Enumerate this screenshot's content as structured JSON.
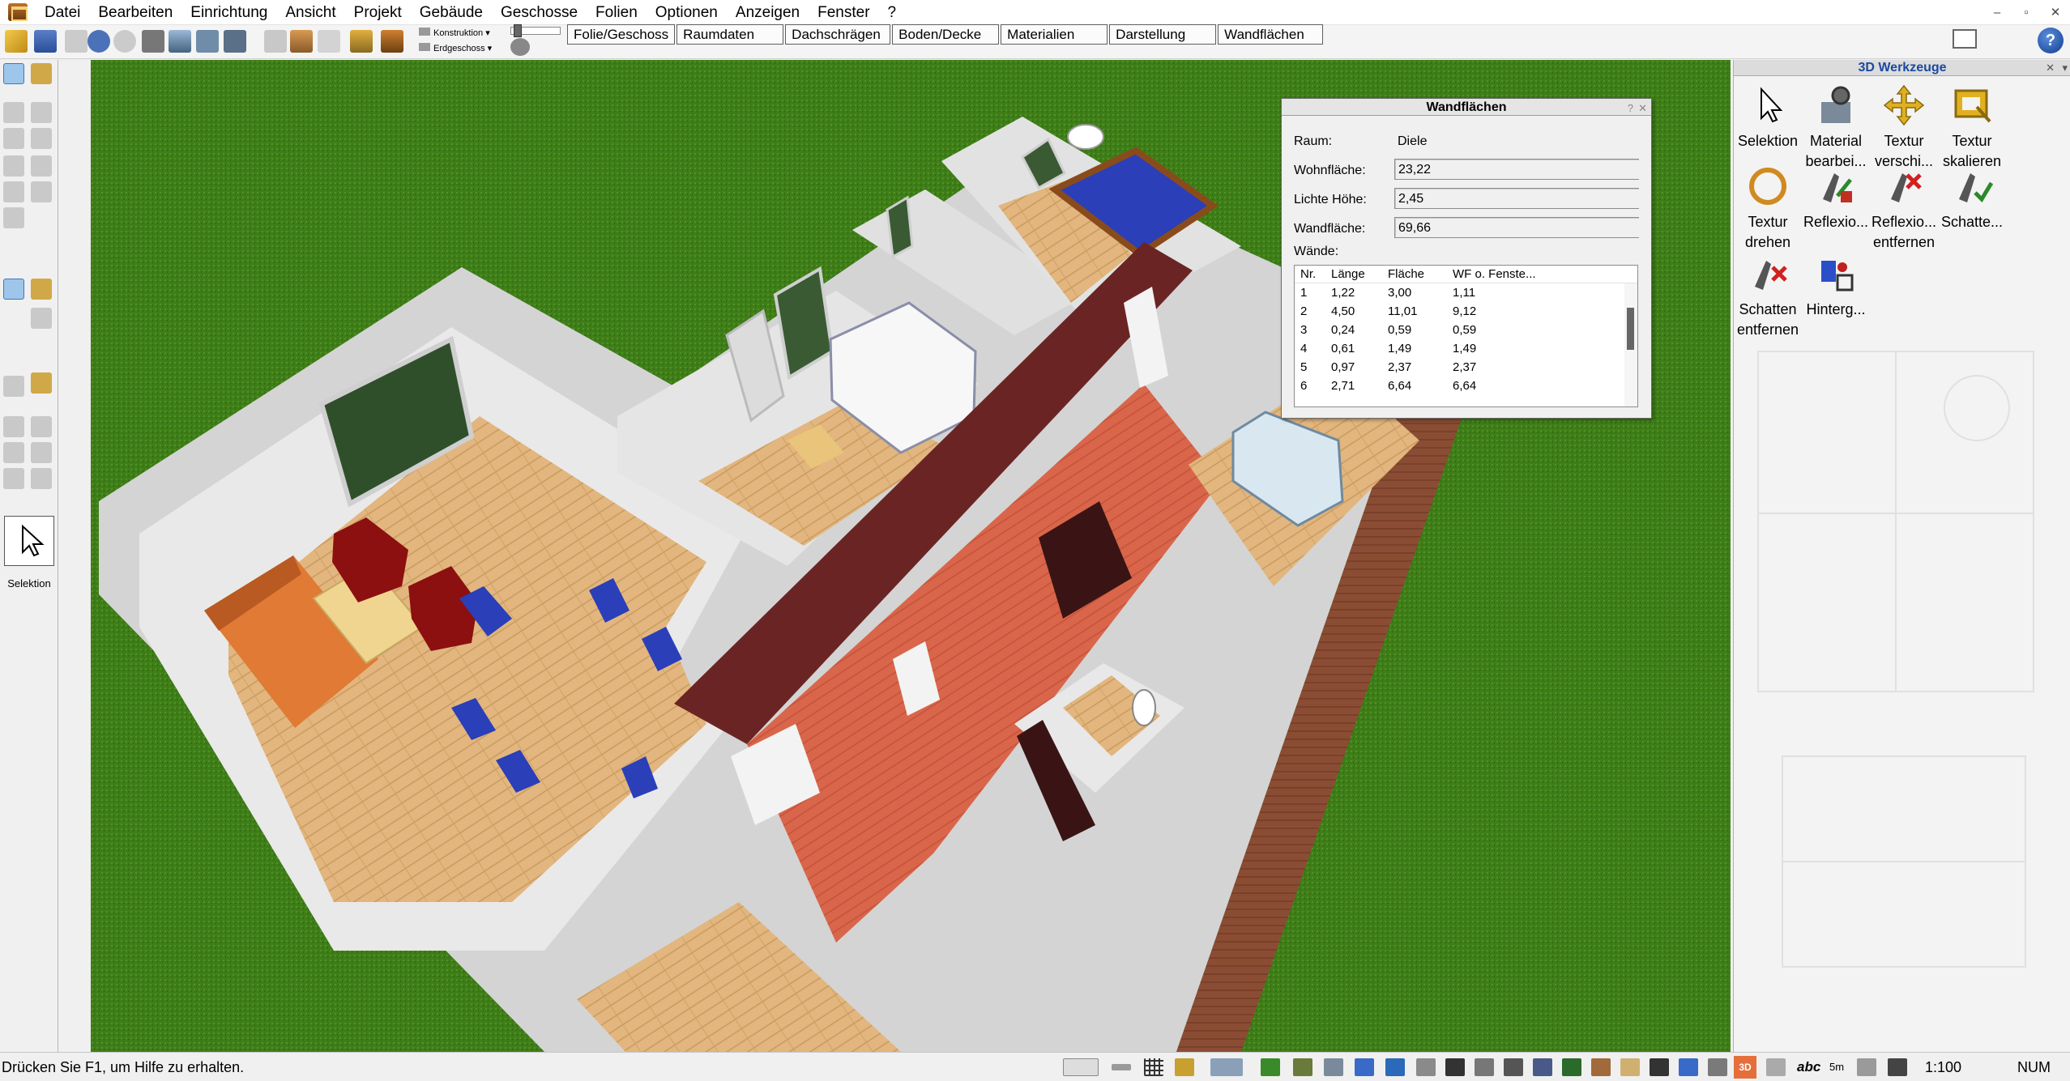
{
  "menu": [
    "Datei",
    "Bearbeiten",
    "Einrichtung",
    "Ansicht",
    "Projekt",
    "Gebäude",
    "Geschosse",
    "Folien",
    "Optionen",
    "Anzeigen",
    "Fenster",
    "?"
  ],
  "window_controls": [
    "–",
    "▫",
    "✕"
  ],
  "toolbar": {
    "konstruktion_label": "Konstruktion ▾",
    "erdgeschoss_label": "Erdgeschoss ▾"
  },
  "tabs": [
    "Folie/Geschoss",
    "Raumdaten",
    "Dachschrägen",
    "Boden/Decke",
    "Materialien",
    "Darstellung",
    "Wandflächen"
  ],
  "help_label": "?",
  "left_strip": {
    "selection_label": "Selektion"
  },
  "dialog": {
    "title": "Wandflächen",
    "title_controls": [
      "?",
      "✕"
    ],
    "raum_label": "Raum:",
    "raum_value": "Diele",
    "wohnflaeche_label": "Wohnfläche:",
    "wohnflaeche_value": "23,22",
    "lichte_hoehe_label": "Lichte Höhe:",
    "lichte_hoehe_value": "2,45",
    "wandflaeche_label": "Wandfläche:",
    "wandflaeche_value": "69,66",
    "waende_label": "Wände:",
    "columns": [
      "Nr.",
      "Länge",
      "Fläche",
      "WF o. Fenste..."
    ],
    "rows": [
      [
        "1",
        "1,22",
        "3,00",
        "1,11"
      ],
      [
        "2",
        "4,50",
        "11,01",
        "9,12"
      ],
      [
        "3",
        "0,24",
        "0,59",
        "0,59"
      ],
      [
        "4",
        "0,61",
        "1,49",
        "1,49"
      ],
      [
        "5",
        "0,97",
        "2,37",
        "2,37"
      ],
      [
        "6",
        "2,71",
        "6,64",
        "6,64"
      ]
    ]
  },
  "right_panel": {
    "title": "3D Werkzeuge",
    "title_controls": [
      "✕",
      "▾"
    ],
    "tools": [
      {
        "label1": "Selektion",
        "label2": "",
        "icon": "cursor-icon"
      },
      {
        "label1": "Material",
        "label2": "bearbei...",
        "icon": "material-edit-icon"
      },
      {
        "label1": "Textur",
        "label2": "verschi...",
        "icon": "texture-move-icon"
      },
      {
        "label1": "Textur",
        "label2": "skalieren",
        "icon": "texture-scale-icon"
      },
      {
        "label1": "Textur",
        "label2": "drehen",
        "icon": "texture-rotate-icon"
      },
      {
        "label1": "Reflexio...",
        "label2": "",
        "icon": "reflection-icon"
      },
      {
        "label1": "Reflexio...",
        "label2": "entfernen",
        "icon": "reflection-remove-icon"
      },
      {
        "label1": "Schatte...",
        "label2": "",
        "icon": "shadow-icon"
      },
      {
        "label1": "Schatten",
        "label2": "entfernen",
        "icon": "shadow-remove-icon"
      },
      {
        "label1": "Hinterg...",
        "label2": "",
        "icon": "background-icon"
      }
    ]
  },
  "status": {
    "text": "Drücken Sie F1, um Hilfe zu erhalten.",
    "mode_3d": "3D",
    "abc": "abc",
    "five_m": "5m",
    "scale": "1:100",
    "num": "NUM"
  },
  "colors": {
    "grass": "#3e7d18",
    "wood_floor": "#e2b67e",
    "hall_floor": "#d9664a",
    "wall_white": "#d6d6d6",
    "wall_dark_red": "#6b2424",
    "furniture_blue": "#2a3fb8",
    "sofa_orange": "#e07a35",
    "armchair_red": "#8c1010",
    "title_blue": "#1a4aa0"
  }
}
